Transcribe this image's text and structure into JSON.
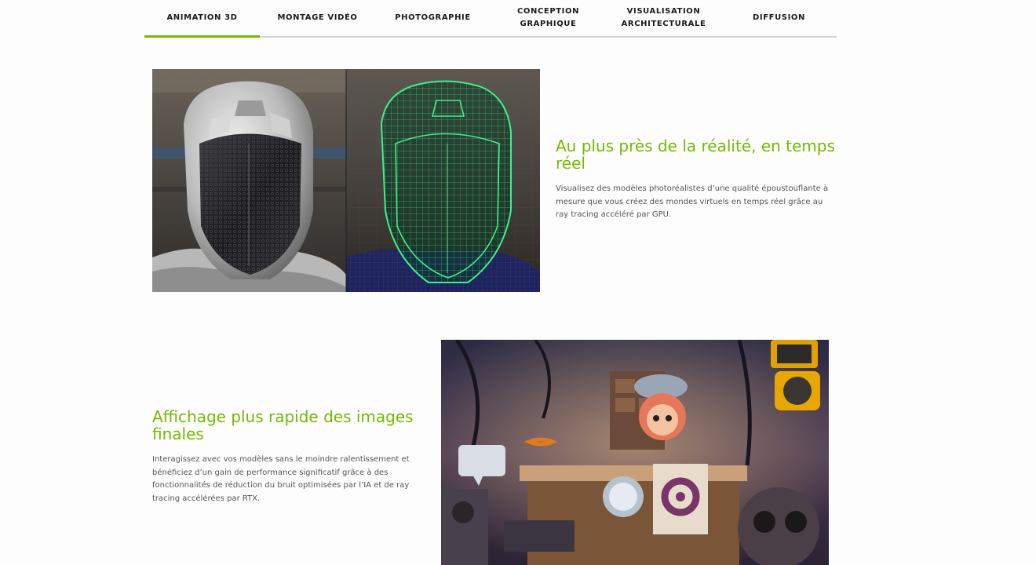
{
  "tabs": [
    {
      "label": "ANIMATION 3D",
      "active": true
    },
    {
      "label": "MONTAGE VIDÉO",
      "active": false
    },
    {
      "label": "PHOTOGRAPHIE",
      "active": false
    },
    {
      "label": "CONCEPTION\nGRAPHIQUE",
      "active": false
    },
    {
      "label": "VISUALISATION\nARCHITECTURALE",
      "active": false
    },
    {
      "label": "DIFFUSION",
      "active": false
    }
  ],
  "features": [
    {
      "title": "Au plus près de la réalité, en temps réel",
      "description": "Visualisez des modèles photoréalistes d’une qualité époustouflante à mesure que vous créez des mondes virtuels en temps réel grâce au ray tracing accéléré par GPU."
    },
    {
      "title": "Affichage plus rapide des images finales",
      "description": "Interagissez avec vos modèles sans le moindre ralentissement et bénéficiez d’un gain de performance significatif grâce à des fonctionnalités de réduction du bruit optimisées par l’IA et de ray tracing accélérées par RTX."
    }
  ],
  "colors": {
    "accent": "#76b900",
    "wireframe": "#3ef08c"
  }
}
